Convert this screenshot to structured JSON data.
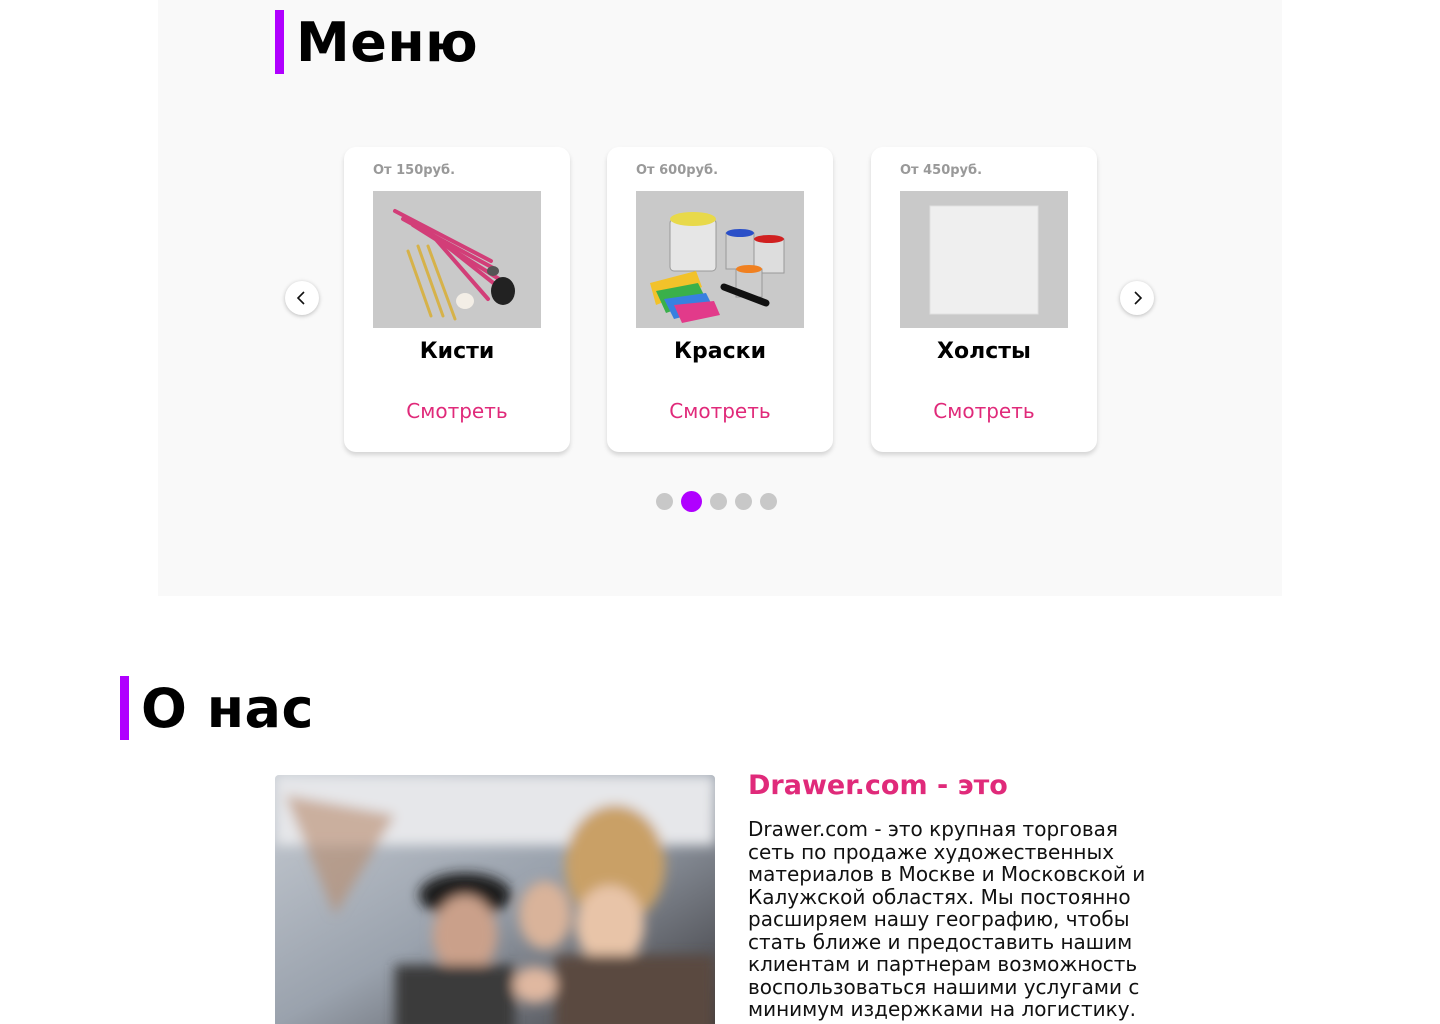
{
  "menu": {
    "title": "Меню",
    "cards": [
      {
        "price": "От 150руб.",
        "name": "Кисти",
        "link": "Смотреть"
      },
      {
        "price": "От 600руб.",
        "name": "Краски",
        "link": "Смотреть"
      },
      {
        "price": "От 450руб.",
        "name": "Холсты",
        "link": "Смотреть"
      }
    ],
    "pagination": {
      "count": 5,
      "active": 2
    }
  },
  "about": {
    "title": "О нас",
    "heading": "Drawer.com - это",
    "text": "Drawer.com - это крупная торговая сеть по продаже художественных материалов в Москве и Московской и Калужской областях. Мы постоянно расширяем нашу географию, чтобы стать ближе и предоставить нашим клиентам и партнерам возможность воспользоваться нашими услугами с минимум издержками на логистику."
  },
  "colors": {
    "accent_bar": "#b000ff",
    "link": "#e02a7a",
    "dot_active": "#b000ff",
    "dot": "#c8c8c8"
  },
  "icons": {
    "prev": "chevron-left-icon",
    "next": "chevron-right-icon"
  }
}
